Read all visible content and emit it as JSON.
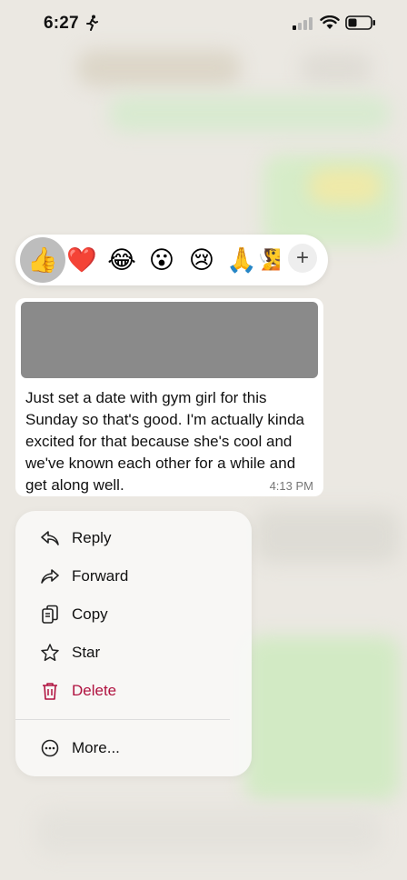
{
  "status_bar": {
    "time": "6:27"
  },
  "reactions": [
    {
      "emoji": "👍",
      "selected": true
    },
    {
      "emoji": "❤️"
    },
    {
      "emoji": "😂"
    },
    {
      "emoji": "😮"
    },
    {
      "emoji": "😢"
    },
    {
      "emoji": "🙏"
    },
    {
      "emoji": "🧏"
    }
  ],
  "reactions_more": "+",
  "message": {
    "text": "Just set a date with gym girl for this Sunday so that's good. I'm actually kinda excited for that because she's cool and we've known each other for a while and get along well.",
    "time": "4:13 PM"
  },
  "menu": {
    "reply": "Reply",
    "forward": "Forward",
    "copy": "Copy",
    "star": "Star",
    "delete": "Delete",
    "more": "More..."
  },
  "colors": {
    "delete": "#b0123f",
    "selected_reaction": "#bdbdbd"
  }
}
